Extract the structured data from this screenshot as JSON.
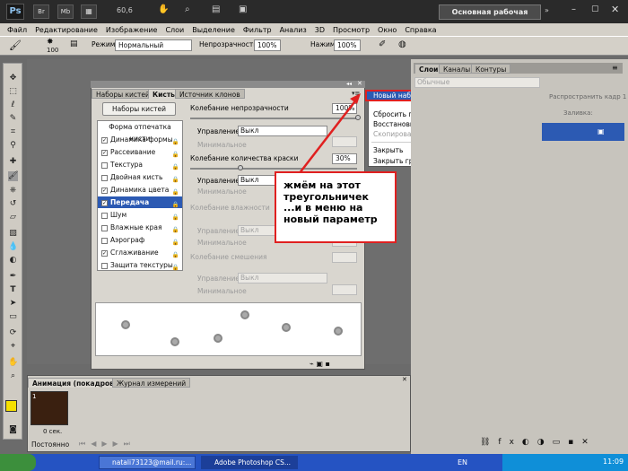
{
  "app": {
    "logo": "Ps",
    "zoom": "60,6",
    "workspace": "Основная рабочая среда"
  },
  "menu": [
    "Файл",
    "Редактирование",
    "Изображение",
    "Слои",
    "Выделение",
    "Фильтр",
    "Анализ",
    "3D",
    "Просмотр",
    "Окно",
    "Справка"
  ],
  "options": {
    "brush_size": "100",
    "mode_label": "Режим:",
    "mode_value": "Нормальный",
    "opacity_label": "Непрозрачность:",
    "opacity_value": "100%",
    "pressure_label": "Нажим:",
    "pressure_value": "100%"
  },
  "brush_panel": {
    "tabs": [
      "Наборы кистей",
      "Кисть",
      "Источник клонов"
    ],
    "presets_button": "Наборы кистей",
    "tip_shape": "Форма отпечатка кисти",
    "items": [
      {
        "label": "Динамика формы",
        "checked": true
      },
      {
        "label": "Рассеивание",
        "checked": true
      },
      {
        "label": "Текстура",
        "checked": false
      },
      {
        "label": "Двойная кисть",
        "checked": false
      },
      {
        "label": "Динамика цвета",
        "checked": true
      },
      {
        "label": "Передача",
        "checked": true,
        "selected": true
      },
      {
        "label": "Шум",
        "checked": false
      },
      {
        "label": "Влажные края",
        "checked": false
      },
      {
        "label": "Аэрограф",
        "checked": false
      },
      {
        "label": "Сглаживание",
        "checked": true
      },
      {
        "label": "Защита текстуры",
        "checked": false
      }
    ],
    "right": {
      "opacity_jitter": "Колебание непрозрачности",
      "opacity_jitter_value": "100%",
      "control_label": "Управление:",
      "control_value": "Выкл",
      "minimum_label": "Минимальное",
      "flow_jitter": "Колебание количества краски",
      "flow_jitter_value": "30%",
      "wetness_jitter": "Колебание влажности",
      "mix_jitter": "Колебание смешения"
    }
  },
  "dropdown": {
    "items": [
      {
        "label": "Новый набор параметров кисти...",
        "highlighted": true
      },
      {
        "label": "Сбросить параметры кисти",
        "dim": false
      },
      {
        "label": "Восстановить все заблокированные настройки",
        "dim": false
      },
      {
        "label": "Скопировать текстуру в другие инструменты",
        "dim": true
      },
      {
        "label": "Закрыть",
        "dim": false
      },
      {
        "label": "Закрыть группу вкладок",
        "dim": false
      }
    ]
  },
  "callout": "жмём на этот треугольничек ...и в меню на новый параметр",
  "layers": {
    "tabs": [
      "Слои",
      "Каналы",
      "Контуры"
    ],
    "blend": "Обычные",
    "spread": "Распространить кадр 1",
    "fill": "Заливка:"
  },
  "animation": {
    "tabs": [
      "Анимация (покадровая)",
      "Журнал измерений"
    ],
    "frame_number": "1",
    "frame_time": "0 сек.",
    "loop": "Постоянно"
  },
  "taskbar": {
    "items": [
      "natali73123@mail.ru:...",
      "Adobe Photoshop CS..."
    ],
    "lang": "EN",
    "time": "11:09"
  },
  "colors": {
    "accent": "#2c5ab3",
    "annotation": "#e02020",
    "foreground_swatch": "#f5e000"
  }
}
